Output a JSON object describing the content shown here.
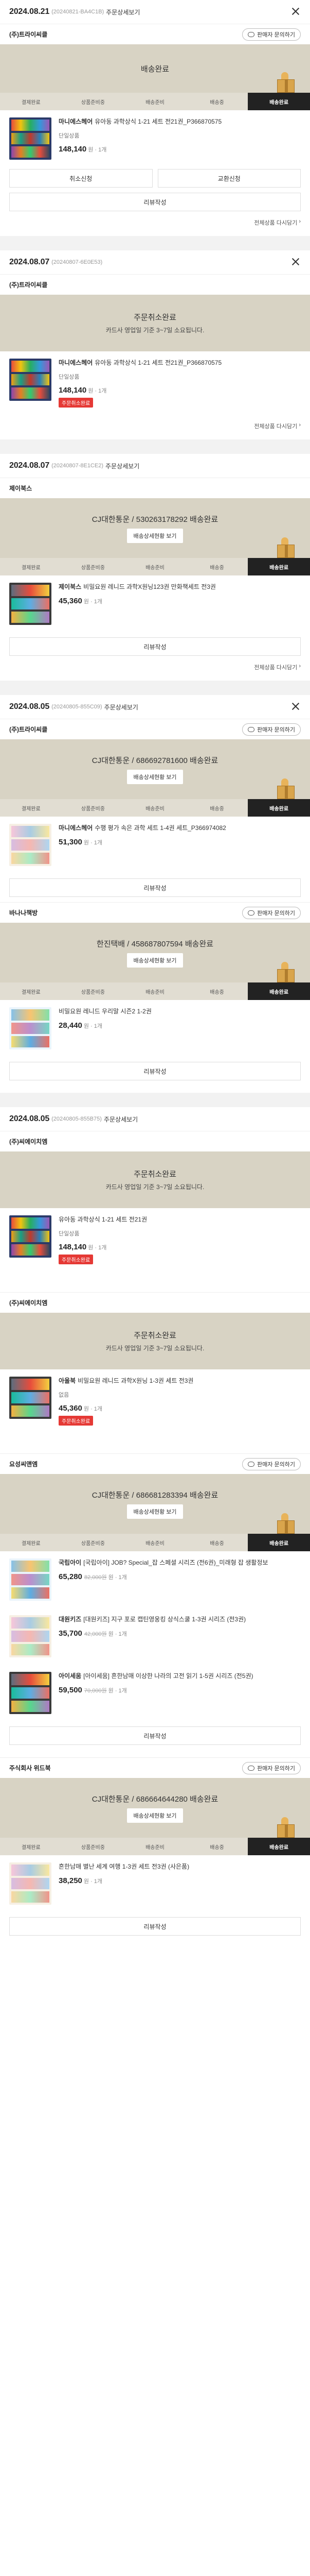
{
  "common": {
    "contact": "판매자 문의하기",
    "detail": "주문상세보기",
    "track": "배송상세현황 보기",
    "review": "리뷰작성",
    "reorder": "전체상품 다시담기",
    "cancel_req": "취소신청",
    "exchange_req": "교환신청",
    "qty_suffix": "원 · 1개",
    "tag_done": "주문취소완료",
    "steps": [
      "결제완료",
      "상품준비중",
      "배송준비",
      "배송중",
      "배송완료"
    ]
  },
  "orders": [
    {
      "date": "2024.08.21",
      "no": "(20240821-BA4C1B)",
      "seller": "(주)트라이씨클",
      "status_title": "배송완료",
      "item": {
        "brand": "마니에스헤어",
        "name": "유아동 과학상식 1-21 세트 전21권_P366870575",
        "opt": "단일상품",
        "price": "148,140"
      }
    },
    {
      "date": "2024.08.07",
      "no": "(20240807-6E0E53)",
      "seller": "(주)트라이씨클",
      "status_title": "주문취소완료",
      "status_sub": "카드사 영업일 기준 3~7일 소요됩니다.",
      "item": {
        "brand": "마니에스헤어",
        "name": "유아동 과학상식 1-21 세트 전21권_P366870575",
        "opt": "단일상품",
        "price": "148,140"
      }
    },
    {
      "date": "2024.08.07",
      "no": "(20240807-8E1CE2)",
      "seller": "제이북스",
      "status_title": "CJ대한통운 / 530263178292 배송완료",
      "item": {
        "brand": "제이북스",
        "name": "비밀요원 레니드 과학X원닝123권 만화책세트 전3권",
        "price": "45,360"
      }
    },
    {
      "date": "2024.08.05",
      "no": "(20240805-855C09)",
      "seller": "(주)트라이씨클",
      "status_title": "CJ대한통운 / 686692781600 배송완료",
      "item": {
        "brand": "마니에스헤어",
        "name": "수행 평가 속은 과학 세트 1-4권 세트_P366974082",
        "price": "51,300"
      },
      "seller2": "바나나책방",
      "status2": "한진택배 / 458687807594 배송완료",
      "item2": {
        "name": "비밀요원 레니드 우리말 시즌2 1-2권",
        "price": "28,440"
      }
    },
    {
      "date": "2024.08.05",
      "no": "(20240805-855B75)",
      "s1": {
        "seller": "(주)씨에이치엠",
        "status_title": "주문취소완료",
        "status_sub": "카드사 영업일 기준 3~7일 소요됩니다.",
        "name": "유아동 과학상식 1-21 세트 전21권",
        "opt": "단일상품",
        "price": "148,140"
      },
      "s2": {
        "seller": "(주)씨에이치엠",
        "status_title": "주문취소완료",
        "status_sub": "카드사 영업일 기준 3~7일 소요됩니다.",
        "brand": "아울북",
        "name": "비밀요원 레니드 과학X원닝 1-3권 세트 전3권",
        "opt": "없음",
        "price": "45,360"
      },
      "s3": {
        "seller": "요성씨앤엠",
        "status_title": "CJ대한통운 / 686681283394 배송완료",
        "items": [
          {
            "brand": "국립아이",
            "name": "[국립아이] JOB? Special_잡 스페셜 시리즈 (전6권)_미래형 잡 생활정보",
            "price": "65,280",
            "orig": "82,000원",
            "opt": ""
          },
          {
            "brand": "대원키즈",
            "name": "[대원키즈] 지구 포로 캡틴영웅킹 상식스쿨 1-3권 시리즈 (전3권)",
            "price": "35,700",
            "orig": "42,000원",
            "opt": ""
          },
          {
            "brand": "아이세움",
            "name": "[아이세움] 흔한남매 이상한 나라의 고전 읽기 1-5권 시리즈 (전5권)",
            "price": "59,500",
            "orig": "70,000원",
            "opt": ""
          }
        ]
      },
      "s4": {
        "seller": "주식회사 위드북",
        "status_title": "CJ대한통운 / 686664644280 배송완료",
        "name": "흔한남매 별난 세계 여행 1-3권 세트 전3권 (사은품)",
        "price": "38,250"
      }
    }
  ]
}
